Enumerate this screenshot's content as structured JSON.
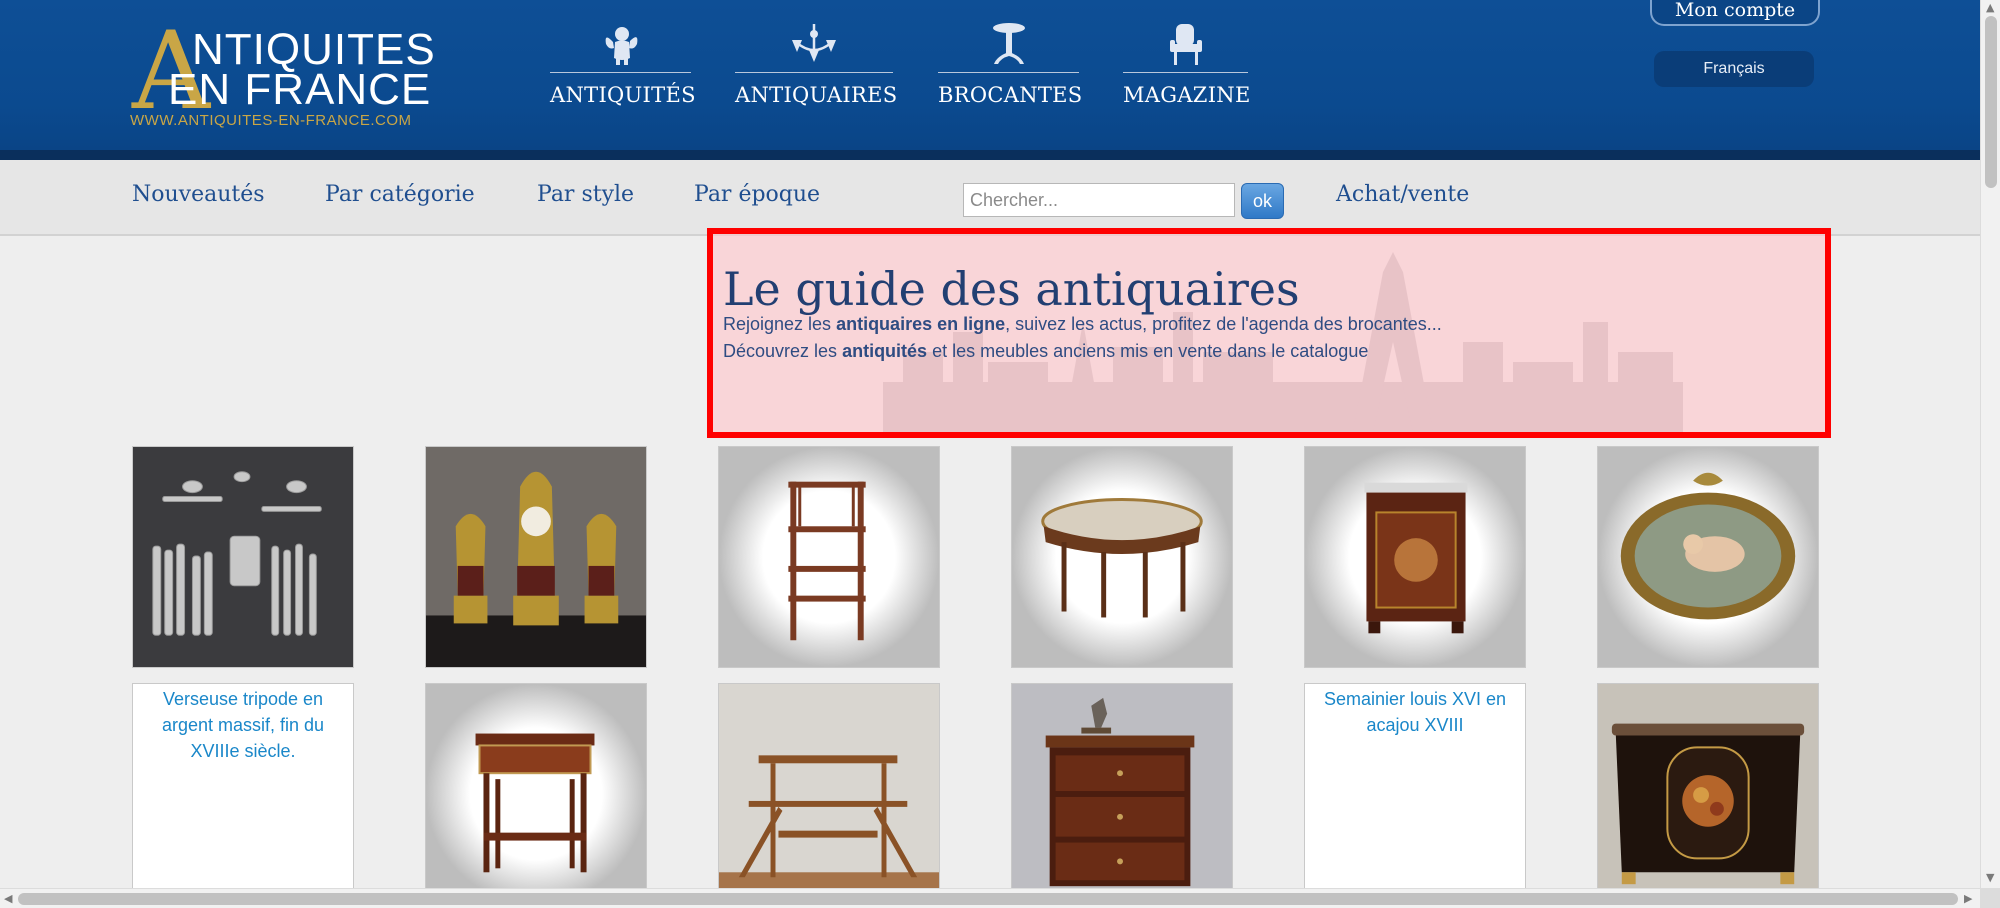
{
  "header": {
    "logo": {
      "line1": "NTIQUITES",
      "line2": "EN FRANCE",
      "url": "WWW.ANTIQUITES-EN-FRANCE.COM",
      "big_letter": "A"
    },
    "nav": [
      {
        "label": "ANTIQUITÉS",
        "icon": "cherub-icon"
      },
      {
        "label": "ANTIQUAIRES",
        "icon": "chandelier-icon"
      },
      {
        "label": "BROCANTES",
        "icon": "pedestal-table-icon"
      },
      {
        "label": "MAGAZINE",
        "icon": "armchair-icon"
      }
    ],
    "account_label": "Mon compte",
    "language_label": "Français"
  },
  "subnav": {
    "links": [
      "Nouveautés",
      "Par catégorie",
      "Par style",
      "Par époque"
    ],
    "search_placeholder": "Chercher...",
    "search_button": "ok",
    "buy_sell_label": "Achat/vente"
  },
  "intro": {
    "title": "Le guide des antiquaires",
    "line1_pre": "Rejoignez les ",
    "line1_bold": "antiquaires en ligne",
    "line1_post": ", suivez les actus, profitez de l'agenda des brocantes...",
    "line2_pre": "Découvrez les ",
    "line2_bold": "antiquités",
    "line2_post": " et les meubles anciens mis en vente dans le catalogue"
  },
  "products": [
    {
      "kind": "silverware",
      "alt": ""
    },
    {
      "kind": "clock-garniture",
      "alt": ""
    },
    {
      "kind": "etagere",
      "alt": ""
    },
    {
      "kind": "oval-table",
      "alt": ""
    },
    {
      "kind": "cabinet",
      "alt": ""
    },
    {
      "kind": "oval-painting",
      "alt": ""
    },
    {
      "kind": "broken",
      "alt": "Verseuse tripode en argent massif, fin du XVIIIe siècle."
    },
    {
      "kind": "side-table",
      "alt": ""
    },
    {
      "kind": "tiered-table",
      "alt": ""
    },
    {
      "kind": "commode-sculpture",
      "alt": ""
    },
    {
      "kind": "broken",
      "alt": "Semainier louis XVI en acajou XVIII"
    },
    {
      "kind": "marquetry-buffet",
      "alt": ""
    }
  ],
  "colors": {
    "header_blue": "#0e4f96",
    "accent_gold": "#c9a646",
    "link_blue": "#1f4e8f",
    "highlight_red": "#ff0000"
  }
}
